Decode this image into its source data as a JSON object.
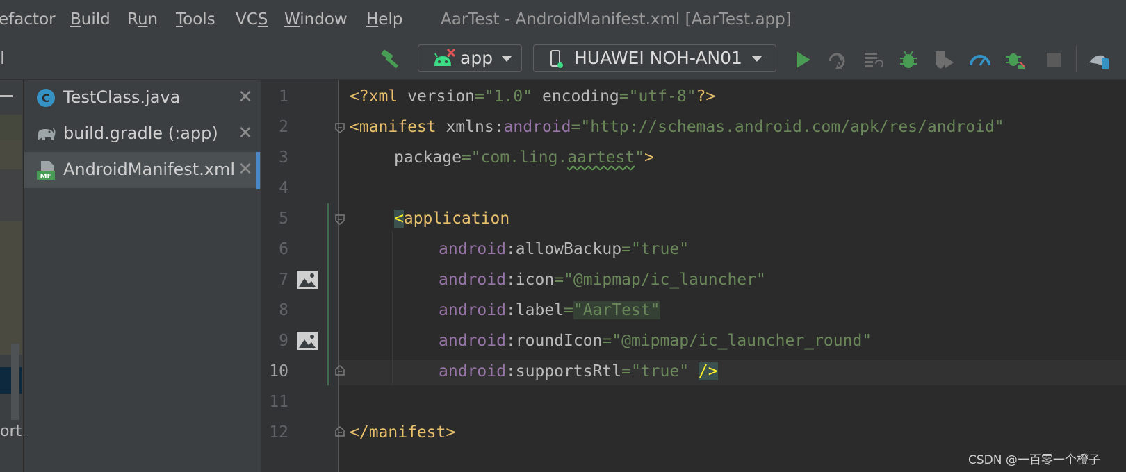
{
  "menubar": {
    "items": [
      {
        "label": "efactor"
      },
      {
        "label": "Build",
        "mnemonic": "B",
        "rest": "uild"
      },
      {
        "label": "Run",
        "pre": "R",
        "mnemonic": "u",
        "rest": "n"
      },
      {
        "label": "Tools",
        "mnemonic": "T",
        "rest": "ools"
      },
      {
        "label": "VCS",
        "pre": "VC",
        "mnemonic": "S",
        "rest": ""
      },
      {
        "label": "Window",
        "mnemonic": "W",
        "rest": "indow"
      },
      {
        "label": "Help",
        "mnemonic": "H",
        "rest": "elp"
      }
    ],
    "window_title": "AarTest - AndroidManifest.xml [AarTest.app]"
  },
  "toolbar": {
    "left_fragment": "l",
    "run_config": "app",
    "device": "HUAWEI NOH-AN01",
    "icons": [
      "build-hammer-icon",
      "android-app-icon",
      "phone-device-icon",
      "run-icon",
      "apply-changes-restart-icon",
      "apply-code-changes-icon",
      "debug-icon",
      "run-with-coverage-icon",
      "profile-icon",
      "attach-debugger-icon",
      "stop-icon",
      "device-manager-icon"
    ]
  },
  "left_strip": {
    "fragment": "ort."
  },
  "files": [
    {
      "name": "TestClass.java",
      "icon": "java-class-icon"
    },
    {
      "name": "build.gradle (:app)",
      "icon": "gradle-elephant-icon"
    },
    {
      "name": "AndroidManifest.xml",
      "icon": "manifest-icon",
      "selected": true
    }
  ],
  "editor": {
    "line_numbers": [
      "1",
      "2",
      "3",
      "4",
      "5",
      "6",
      "7",
      "8",
      "9",
      "10",
      "11",
      "12"
    ],
    "current_line": "10",
    "code": {
      "l1_a": "<?xml ",
      "l1_b": "version",
      "l1_c": "=",
      "l1_d": "\"1.0\"",
      "l1_e": " encoding",
      "l1_f": "=",
      "l1_g": "\"utf-8\"",
      "l1_h": "?>",
      "l2_a": "<manifest ",
      "l2_b": "xmlns:",
      "l2_c": "android",
      "l2_d": "=",
      "l2_e": "\"http://schemas.android.com/apk/res/android\"",
      "l3_a": "package",
      "l3_b": "=",
      "l3_c": "\"com.ling.",
      "l3_d": "aartest",
      "l3_e": "\"",
      "l3_f": ">",
      "l5_a": "<",
      "l5_b": "application",
      "l6_a": "android",
      "l6_b": ":allowBackup",
      "l6_c": "=",
      "l6_d": "\"true\"",
      "l7_a": "android",
      "l7_b": ":icon",
      "l7_c": "=",
      "l7_d": "\"@mipmap/ic_launcher\"",
      "l8_a": "android",
      "l8_b": ":label",
      "l8_c": "=",
      "l8_d": "\"AarTest\"",
      "l9_a": "android",
      "l9_b": ":roundIcon",
      "l9_c": "=",
      "l9_d": "\"@mipmap/ic_launcher_round\"",
      "l10_a": "android",
      "l10_b": ":supportsRtl",
      "l10_c": "=",
      "l10_d": "\"true\"",
      "l10_e": " ",
      "l10_f": "/>",
      "l12_a": "</manifest>"
    }
  },
  "watermark": "CSDN @一百零一个橙子",
  "colors": {
    "background": "#2b2b2b",
    "panel": "#3c3f41",
    "tag": "#e8bf6a",
    "attribute_namespace": "#9876aa",
    "value": "#6a8759",
    "selection_accent": "#4a88c7",
    "run_green": "#499c54"
  }
}
